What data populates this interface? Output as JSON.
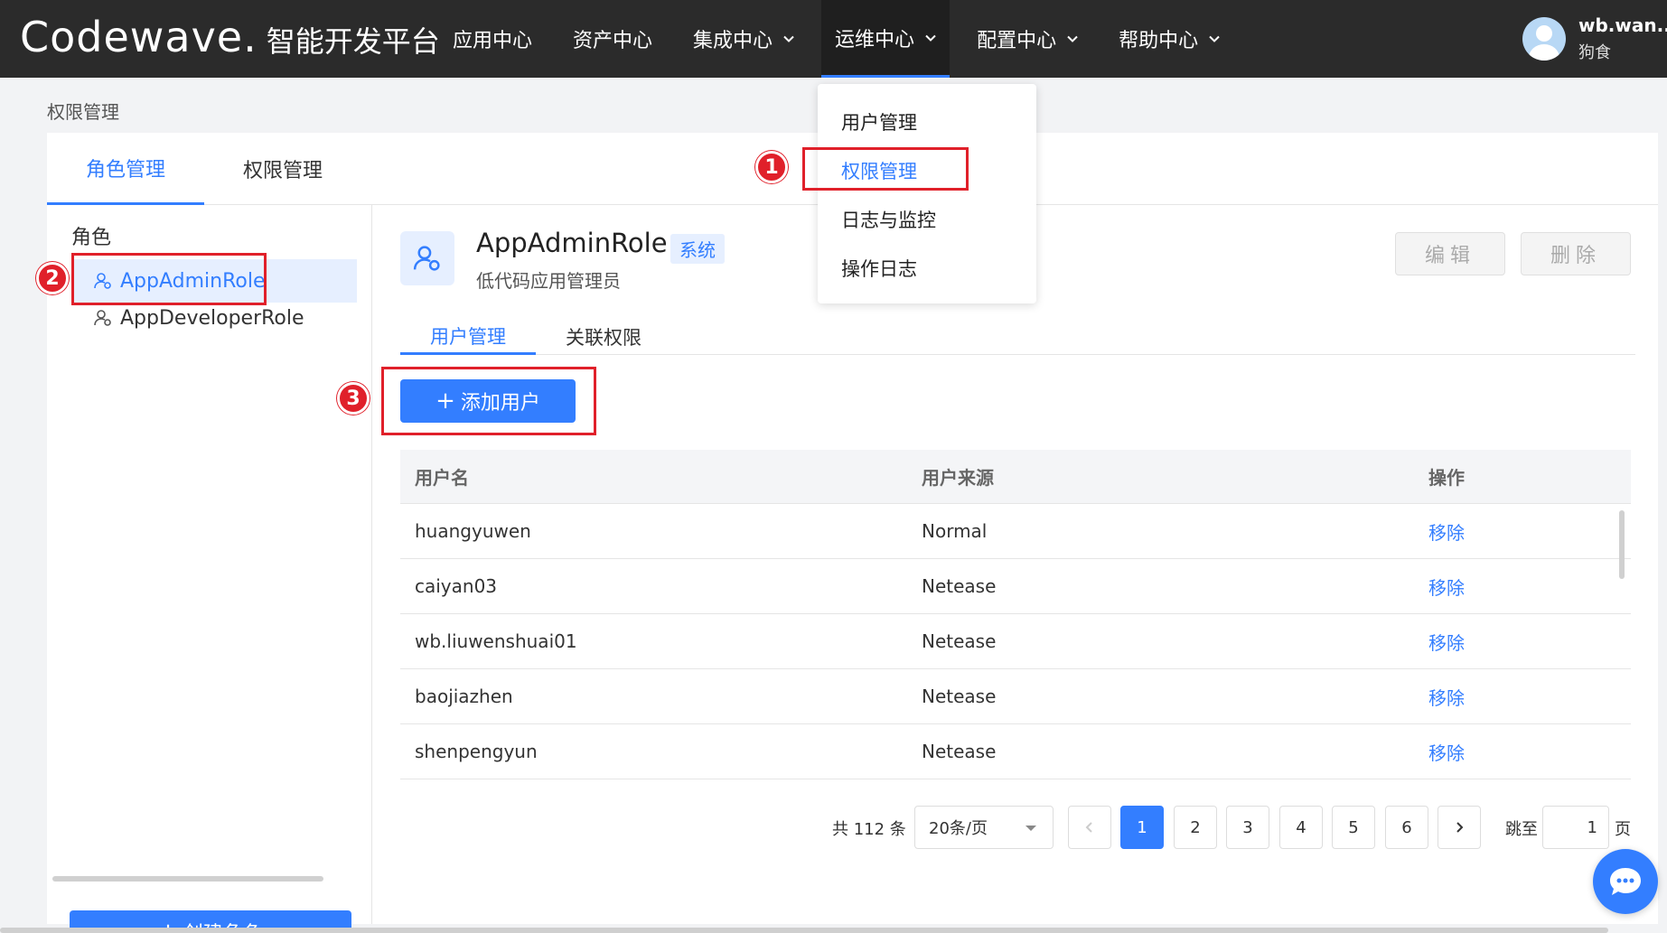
{
  "header": {
    "logo_word": "Codewave.",
    "logo_sub": "智能开发平台",
    "nav": [
      {
        "label": "应用中心",
        "has_menu": false
      },
      {
        "label": "资产中心",
        "has_menu": false
      },
      {
        "label": "集成中心",
        "has_menu": true
      },
      {
        "label": "运维中心",
        "has_menu": true,
        "active": true
      },
      {
        "label": "配置中心",
        "has_menu": true
      },
      {
        "label": "帮助中心",
        "has_menu": true
      }
    ],
    "user": {
      "name": "wb.wan...",
      "nickname": "狗食"
    }
  },
  "dropdown": {
    "items": [
      "用户管理",
      "权限管理",
      "日志与监控",
      "操作日志"
    ],
    "active_index": 1
  },
  "breadcrumb": "权限管理",
  "main_tabs": [
    {
      "label": "角色管理",
      "active": true
    },
    {
      "label": "权限管理",
      "active": false
    }
  ],
  "sidebar": {
    "title": "角色",
    "roles": [
      {
        "label": "AppAdminRole",
        "active": true
      },
      {
        "label": "AppDeveloperRole",
        "active": false
      }
    ],
    "create_button": "创建角色"
  },
  "role": {
    "name": "AppAdminRole",
    "badge": "系统",
    "description": "低代码应用管理员",
    "edit_button": "编辑",
    "delete_button": "删除"
  },
  "sub_tabs": [
    {
      "label": "用户管理",
      "active": true
    },
    {
      "label": "关联权限",
      "active": false
    }
  ],
  "add_user_button": "添加用户",
  "table": {
    "columns": [
      "用户名",
      "用户来源",
      "操作"
    ],
    "rows": [
      {
        "username": "huangyuwen",
        "source": "Normal",
        "action": "移除"
      },
      {
        "username": "caiyan03",
        "source": "Netease",
        "action": "移除"
      },
      {
        "username": "wb.liuwenshuai01",
        "source": "Netease",
        "action": "移除"
      },
      {
        "username": "baojiazhen",
        "source": "Netease",
        "action": "移除"
      },
      {
        "username": "shenpengyun",
        "source": "Netease",
        "action": "移除"
      }
    ]
  },
  "pagination": {
    "total_text": "共 112 条",
    "page_size": "20条/页",
    "pages": [
      "1",
      "2",
      "3",
      "4",
      "5",
      "6"
    ],
    "current": "1",
    "jump_label": "跳至",
    "jump_value": "1",
    "page_word": "页"
  },
  "annotations": [
    "1",
    "2",
    "3"
  ],
  "colors": {
    "accent": "#337eff",
    "topbar": "#2b2b2b",
    "annotation": "#e0202a"
  }
}
